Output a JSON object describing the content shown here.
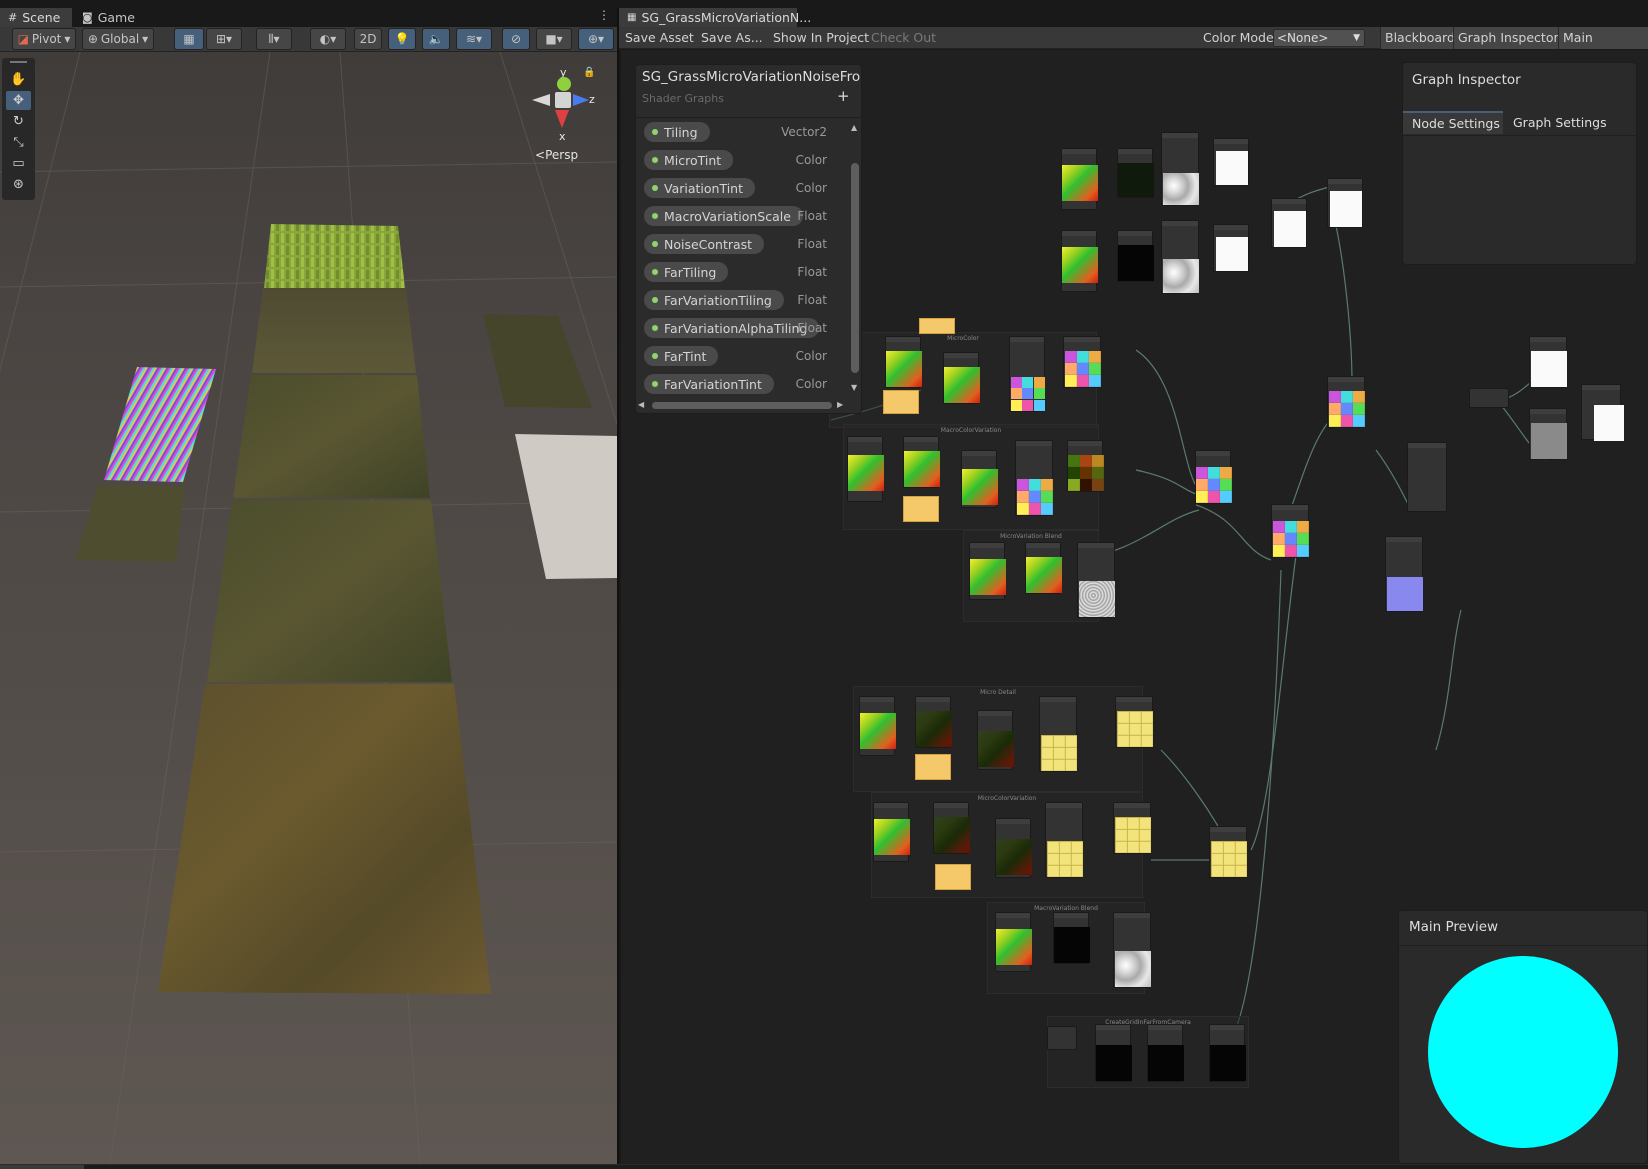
{
  "left_tabs": [
    {
      "icon": "hash-icon",
      "label": "Scene"
    },
    {
      "icon": "gamepad-icon",
      "label": "Game"
    }
  ],
  "scene_toolbar": {
    "pivot": "Pivot",
    "space": "Global",
    "mode_2d": "2D"
  },
  "gizmo": {
    "y": "y",
    "z": "z",
    "x": "x",
    "projection": "Persp"
  },
  "graph_tab": {
    "title": "SG_GrassMicroVariationN..."
  },
  "graph_toolbar": {
    "save_asset": "Save Asset",
    "save_as": "Save As...",
    "show_in_project": "Show In Project",
    "check_out": "Check Out",
    "color_mode_label": "Color Mode",
    "color_mode_value": "<None>",
    "blackboard": "Blackboard",
    "graph_inspector": "Graph Inspector",
    "main_preview": "Main Preview"
  },
  "blackboard": {
    "title": "SG_GrassMicroVariationNoiseFro",
    "subtitle": "Shader Graphs",
    "add": "+",
    "properties": [
      {
        "name": "Tiling",
        "type": "Vector2"
      },
      {
        "name": "MicroTint",
        "type": "Color"
      },
      {
        "name": "VariationTint",
        "type": "Color"
      },
      {
        "name": "MacroVariationScale",
        "type": "Float"
      },
      {
        "name": "NoiseContrast",
        "type": "Float"
      },
      {
        "name": "FarTiling",
        "type": "Float"
      },
      {
        "name": "FarVariationTiling",
        "type": "Float"
      },
      {
        "name": "FarVariationAlphaTiling",
        "type": "Float"
      },
      {
        "name": "FarTint",
        "type": "Color"
      },
      {
        "name": "FarVariationTint",
        "type": "Color"
      }
    ]
  },
  "inspector": {
    "title": "Graph Inspector",
    "tab_node": "Node Settings",
    "tab_graph": "Graph Settings"
  },
  "main_preview": {
    "title": "Main Preview",
    "color": "#00ffff"
  },
  "colors": {
    "accent": "#46607c",
    "preview_sphere": "#00ffff"
  }
}
